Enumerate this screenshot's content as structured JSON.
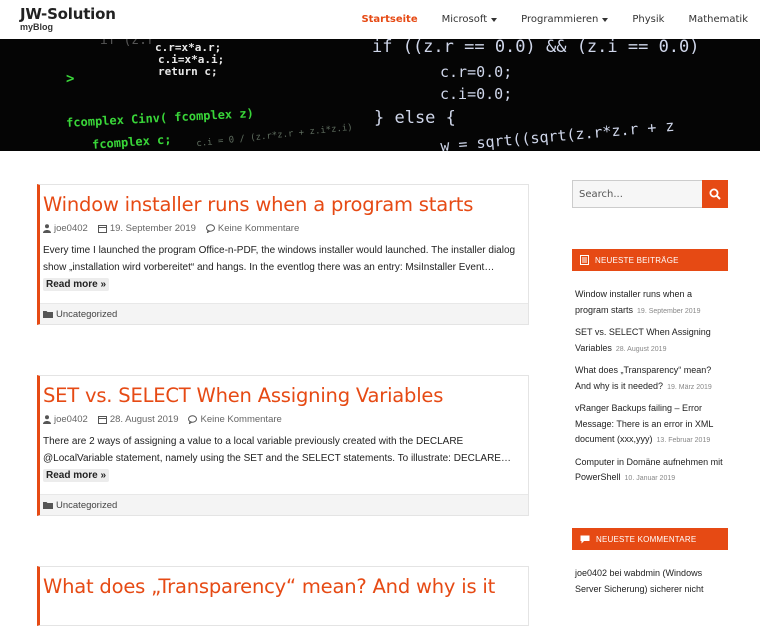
{
  "site": {
    "title": "JW-Solution",
    "tagline": "myBlog"
  },
  "nav": {
    "startseite": "Startseite",
    "microsoft": "Microsoft",
    "programmieren": "Programmieren",
    "physik": "Physik",
    "mathematik": "Mathematik",
    "accent_color": "#e64a14"
  },
  "banner": {
    "left_lines": [
      "if (z.r",
      "c.r=x*a.r;",
      "c.i=x*a.i;",
      "return c;"
    ],
    "left_green_lines": [
      ">",
      "fcomplex Cinv( fcomplex z)",
      "fcomplex c;",
      "c.i = 0 / (z.r*z.r + z.i*z.i)"
    ],
    "right_lines": [
      "if ((z.r == 0.0) && (z.i == 0.0)",
      "c.r=0.0;",
      "c.i=0.0;",
      "} else {",
      "w = sqrt((sqrt(z.r*z.r + z"
    ]
  },
  "posts": [
    {
      "title": "Window installer runs when a program starts",
      "author": "joe0402",
      "date": "19. September 2019",
      "comments": "Keine Kommentare",
      "excerpt": "Every time I launched the program Office-n-PDF, the windows installer would launched. The installer dialog show „installation wird vorbereitet“ and hangs. In the eventlog there was an entry: MsiInstaller Event…",
      "read_more": "Read more »",
      "category": "Uncategorized"
    },
    {
      "title": "SET vs. SELECT When Assigning Variables",
      "author": "joe0402",
      "date": "28. August 2019",
      "comments": "Keine Kommentare",
      "excerpt": "There are 2 ways of assigning a value to a local variable previously created with the DECLARE @LocalVariable statement, namely using the SET and the SELECT statements. To illustrate: DECLARE…",
      "read_more": "Read more »",
      "category": "Uncategorized"
    },
    {
      "title": "What does „Transparency“ mean? And why is it"
    }
  ],
  "sidebar": {
    "search_placeholder": "Search...",
    "recent_posts_title": "NEUESTE BEITRÄGE",
    "recent_posts": [
      {
        "title": "Window installer runs when a program starts",
        "date": "19. September 2019"
      },
      {
        "title": "SET vs. SELECT When Assigning Variables",
        "date": "28. August 2019"
      },
      {
        "title": "What does „Transparency“ mean? And why is it needed?",
        "date": "19. März 2019"
      },
      {
        "title": "vRanger Backups failing – Error Message: There is an error in XML document (xxx,yyy)",
        "date": "13. Februar 2019"
      },
      {
        "title": "Computer in Domäne aufnehmen mit PowerShell",
        "date": "10. Januar 2019"
      }
    ],
    "recent_comments_title": "NEUESTE KOMMENTARE",
    "recent_comment": "joe0402 bei wabdmin (Windows Server Sicherung) sicherer nicht"
  }
}
